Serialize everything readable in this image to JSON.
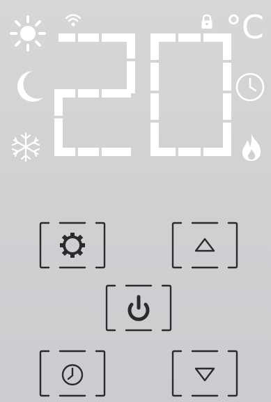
{
  "display": {
    "temperature": "20",
    "unit": "°C",
    "status_icons": [
      "sun-icon",
      "wifi-icon",
      "lock-icon",
      "moon-icon",
      "clock-icon",
      "snowflake-icon",
      "flame-icon"
    ]
  },
  "buttons": [
    "settings-gear-icon",
    "up-arrow-icon",
    "power-icon",
    "clock-icon",
    "down-arrow-icon"
  ],
  "colors": {
    "background": "#d3d4d6",
    "display_white": "#ffffff",
    "button_stroke": "#2a2b2d"
  }
}
